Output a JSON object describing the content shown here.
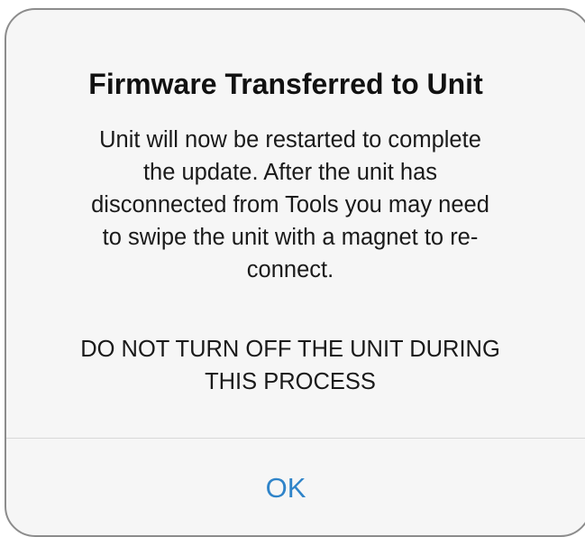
{
  "alert": {
    "title": "Firmware Transferred to Unit",
    "message_lines": [
      "Unit will now be restarted to complete",
      "the update. After the unit has",
      "disconnected from Tools you may need",
      "to swipe the unit with a magnet to re-",
      "connect."
    ],
    "warning_lines": [
      "DO NOT TURN OFF THE UNIT DURING",
      "THIS PROCESS"
    ],
    "ok_label": "OK"
  },
  "colors": {
    "button_text": "#2f84c9",
    "background": "#f6f6f6",
    "border": "#8c8c8c",
    "divider": "#d8d8d8"
  }
}
